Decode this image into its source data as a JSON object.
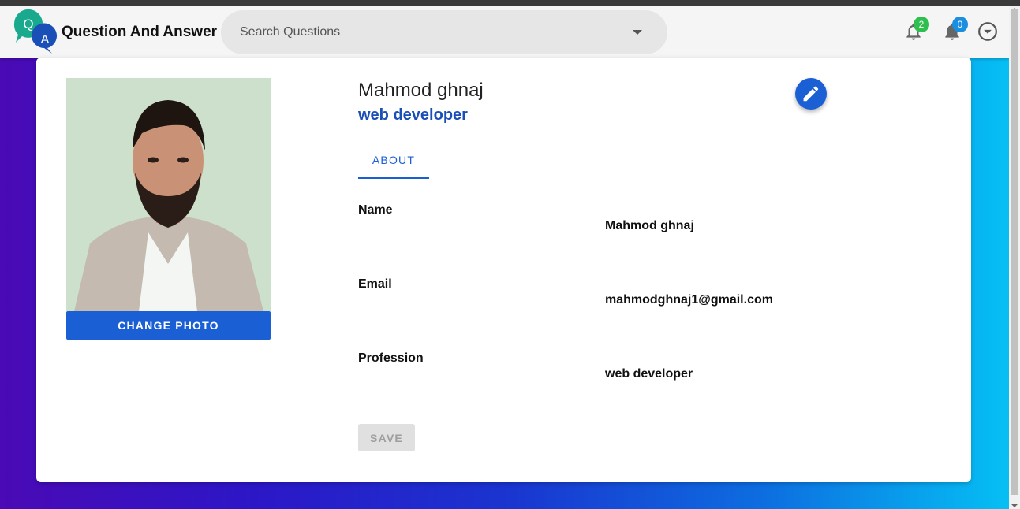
{
  "app": {
    "title": "Question And Answer",
    "logo_letters": [
      "Q",
      "A"
    ]
  },
  "search": {
    "placeholder": "Search Questions"
  },
  "notifications": [
    {
      "icon": "bell-outline-icon",
      "count": "2",
      "color": "#2fbf4f"
    },
    {
      "icon": "bell-filled-icon",
      "count": "0",
      "color": "#1a8fe0"
    }
  ],
  "profile": {
    "name": "Mahmod ghnaj",
    "profession": "web developer",
    "change_photo_label": "CHANGE PHOTO",
    "tab_label": "ABOUT",
    "fields": [
      {
        "label": "Name",
        "value": "Mahmod ghnaj"
      },
      {
        "label": "Email",
        "value": "mahmodghnaj1@gmail.com"
      },
      {
        "label": "Profession",
        "value": "web developer"
      }
    ],
    "save_label": "SAVE"
  },
  "colors": {
    "accent": "#1a5fd4",
    "gradient_start": "#4a0ab5",
    "gradient_end": "#05c3f5"
  }
}
